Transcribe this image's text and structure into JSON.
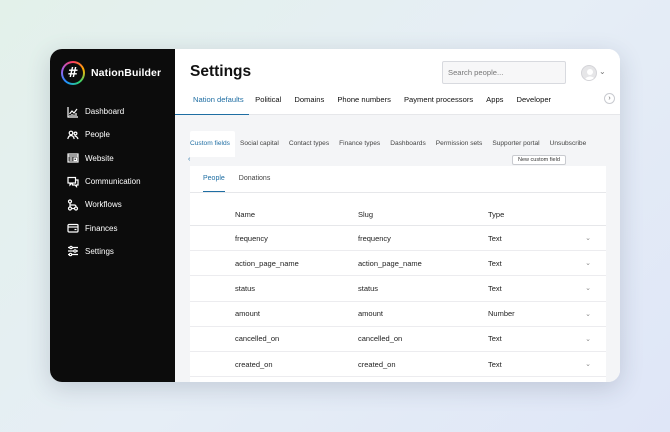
{
  "brand": {
    "name": "NationBuilder",
    "logo_glyph": "#"
  },
  "sidebar": {
    "items": [
      {
        "label": "Dashboard",
        "icon": "chart-icon"
      },
      {
        "label": "People",
        "icon": "people-icon"
      },
      {
        "label": "Website",
        "icon": "website-icon"
      },
      {
        "label": "Communication",
        "icon": "chat-icon"
      },
      {
        "label": "Workflows",
        "icon": "workflow-icon"
      },
      {
        "label": "Finances",
        "icon": "wallet-icon"
      },
      {
        "label": "Settings",
        "icon": "sliders-icon"
      }
    ],
    "active": "Settings"
  },
  "header": {
    "title": "Settings",
    "search_placeholder": "Search people...",
    "tabs": [
      "Nation defaults",
      "Political",
      "Domains",
      "Phone numbers",
      "Payment processors",
      "Apps",
      "Developer"
    ],
    "active_tab": "Nation defaults",
    "next_glyph": "›"
  },
  "subtabs": {
    "items": [
      "Custom fields",
      "Social capital",
      "Contact types",
      "Finance types",
      "Dashboards",
      "Permission sets",
      "Supporter portal",
      "Unsubscribe"
    ],
    "active": "Custom fields",
    "back_glyph": "‹"
  },
  "new_field_button": "New custom field",
  "panel": {
    "tabs": [
      "People",
      "Donations"
    ],
    "active_tab": "People",
    "columns": {
      "name": "Name",
      "slug": "Slug",
      "type": "Type"
    },
    "rows": [
      {
        "name": "frequency",
        "slug": "frequency",
        "type": "Text"
      },
      {
        "name": "action_page_name",
        "slug": "action_page_name",
        "type": "Text"
      },
      {
        "name": "status",
        "slug": "status",
        "type": "Text"
      },
      {
        "name": "amount",
        "slug": "amount",
        "type": "Number"
      },
      {
        "name": "cancelled_on",
        "slug": "cancelled_on",
        "type": "Text"
      },
      {
        "name": "created_on",
        "slug": "created_on",
        "type": "Text"
      }
    ],
    "row_action_glyph": "⌄"
  },
  "colors": {
    "accent": "#1f6ea3",
    "sidebar_bg": "#0c0c0c"
  }
}
